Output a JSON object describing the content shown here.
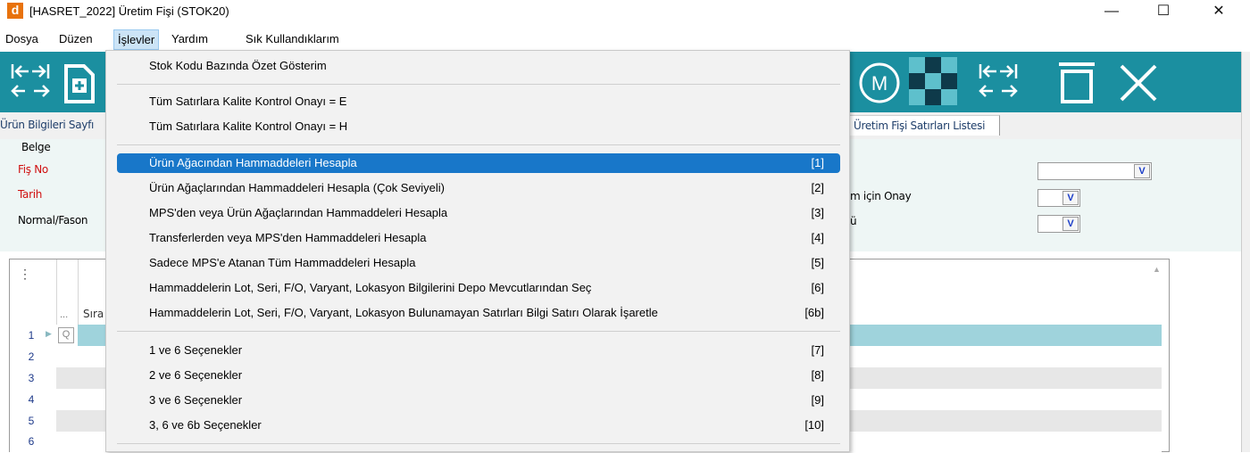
{
  "window": {
    "app_logo": "d",
    "title": "[HASRET_2022] Üretim Fişi (STOK20)",
    "minimize": "—",
    "maximize": "☐",
    "close": "✕"
  },
  "menubar": {
    "items": [
      {
        "label": "Dosya"
      },
      {
        "label": "Düzen"
      },
      {
        "label": "İşlevler"
      },
      {
        "label": "Yardım"
      },
      {
        "label": "Sık Kullandıklarım"
      }
    ]
  },
  "toolbar": {
    "left_icons": [
      "tab-nav-icon",
      "new-document-icon"
    ],
    "right_icons": [
      "m-circle-icon",
      "checker-icon",
      "expand-collapse-icon",
      "delete-icon",
      "close-icon"
    ],
    "m_label": "M"
  },
  "tabs": [
    {
      "label": "Ürün Bilgileri Sayfı"
    },
    {
      "label": "Üretim Fişi Satırları Listesi"
    }
  ],
  "form": {
    "belge_label": "Belge",
    "fis_no_label": "Fiş No",
    "tarih_label": "Tarih",
    "normal_fason_label": "Normal/Fason",
    "right_label_1": "m için Onay",
    "right_label_2": "ü",
    "combo_button": "V"
  },
  "grid": {
    "menu_glyph": "⋮",
    "ellipsis": "...",
    "sira_header": "Sıra",
    "rows": [
      "1",
      "2",
      "3",
      "4",
      "5",
      "6"
    ],
    "selected_row_marker": "▶",
    "search_glyph": "Q"
  },
  "dropdown": {
    "items": [
      {
        "label": "Stok Kodu Bazında Özet Gösterim",
        "key": ""
      },
      {
        "label": "Tüm Satırlara Kalite Kontrol Onayı = E",
        "key": ""
      },
      {
        "label": "Tüm Satırlara Kalite Kontrol Onayı = H",
        "key": ""
      },
      {
        "label": "Ürün Ağacından Hammaddeleri Hesapla",
        "key": "[1]"
      },
      {
        "label": "Ürün Ağaçlarından Hammaddeleri Hesapla (Çok Seviyeli)",
        "key": "[2]"
      },
      {
        "label": "MPS'den veya Ürün Ağaçlarından Hammaddeleri Hesapla",
        "key": "[3]"
      },
      {
        "label": "Transferlerden veya MPS'den Hammaddeleri Hesapla",
        "key": "[4]"
      },
      {
        "label": "Sadece MPS'e Atanan Tüm Hammaddeleri Hesapla",
        "key": "[5]"
      },
      {
        "label": "Hammaddelerin Lot, Seri, F/O, Varyant, Lokasyon Bilgilerini Depo Mevcutlarından Seç",
        "key": "[6]"
      },
      {
        "label": "Hammaddelerin Lot, Seri, F/O, Varyant, Lokasyon Bulunamayan Satırları Bilgi Satırı Olarak İşaretle",
        "key": "[6b]"
      },
      {
        "label": "1 ve 6 Seçenekler",
        "key": "[7]"
      },
      {
        "label": "2 ve 6 Seçenekler",
        "key": "[8]"
      },
      {
        "label": "3 ve 6 Seçenekler",
        "key": "[9]"
      },
      {
        "label": "3, 6 ve 6b Seçenekler",
        "key": "[10]"
      }
    ],
    "selected_index": 3
  },
  "colors": {
    "toolbar": "#1b8fa0",
    "selected_menu": "#1877c9",
    "grid_selected_row": "#9fd3dc",
    "required_label": "#d01010"
  }
}
